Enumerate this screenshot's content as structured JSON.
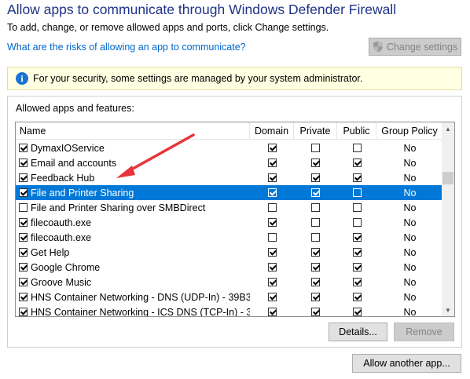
{
  "window": {
    "title": "Allow apps to communicate through Windows Defender Firewall",
    "subtitle": "To add, change, or remove allowed apps and ports, click Change settings.",
    "risk_link": "What are the risks of allowing an app to communicate?",
    "change_settings_label": "Change settings"
  },
  "info_bar": {
    "icon": "info-icon",
    "glyph": "i",
    "text": "For your security, some settings are managed by your system administrator."
  },
  "apps_group": {
    "label": "Allowed apps and features:",
    "columns": {
      "name": "Name",
      "domain": "Domain",
      "private": "Private",
      "public": "Public",
      "group_policy": "Group Policy"
    },
    "rows": [
      {
        "name": "DymaxIOService",
        "enabled": true,
        "domain": true,
        "private": false,
        "public": false,
        "group_policy": "No"
      },
      {
        "name": "Email and accounts",
        "enabled": true,
        "domain": true,
        "private": true,
        "public": true,
        "group_policy": "No"
      },
      {
        "name": "Feedback Hub",
        "enabled": true,
        "domain": true,
        "private": true,
        "public": true,
        "group_policy": "No"
      },
      {
        "name": "File and Printer Sharing",
        "enabled": true,
        "domain": true,
        "private": true,
        "public": false,
        "group_policy": "No",
        "selected": true
      },
      {
        "name": "File and Printer Sharing over SMBDirect",
        "enabled": false,
        "domain": false,
        "private": false,
        "public": false,
        "group_policy": "No"
      },
      {
        "name": "filecoauth.exe",
        "enabled": true,
        "domain": true,
        "private": false,
        "public": false,
        "group_policy": "No"
      },
      {
        "name": "filecoauth.exe",
        "enabled": true,
        "domain": false,
        "private": false,
        "public": true,
        "group_policy": "No"
      },
      {
        "name": "Get Help",
        "enabled": true,
        "domain": true,
        "private": true,
        "public": true,
        "group_policy": "No"
      },
      {
        "name": "Google Chrome",
        "enabled": true,
        "domain": true,
        "private": true,
        "public": true,
        "group_policy": "No"
      },
      {
        "name": "Groove Music",
        "enabled": true,
        "domain": true,
        "private": true,
        "public": true,
        "group_policy": "No"
      },
      {
        "name": "HNS Container Networking - DNS (UDP-In) - 39B3...",
        "enabled": true,
        "domain": true,
        "private": true,
        "public": true,
        "group_policy": "No"
      },
      {
        "name": "HNS Container Networking - ICS DNS (TCP-In) - 3...",
        "enabled": true,
        "domain": true,
        "private": true,
        "public": true,
        "group_policy": "No"
      }
    ],
    "details_label": "Details...",
    "remove_label": "Remove"
  },
  "allow_another_label": "Allow another app...",
  "colors": {
    "title": "#1e3287",
    "link": "#0066cc",
    "selection": "#0078d7",
    "info_bg": "#ffffe1",
    "annotation_arrow": "#e8333a"
  }
}
